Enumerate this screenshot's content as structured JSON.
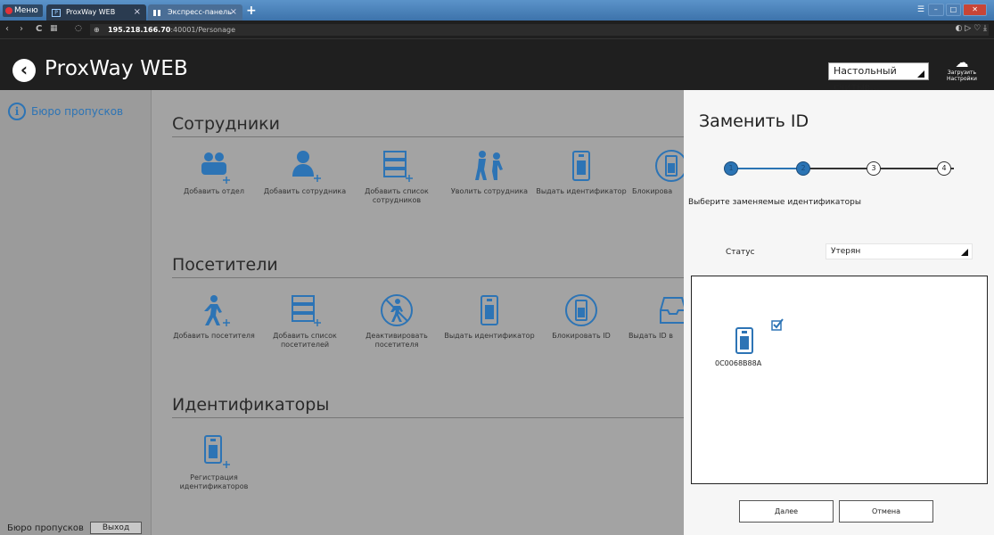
{
  "browser": {
    "menu_label": "Меню",
    "tabs": [
      {
        "label": "ProxWay WEB",
        "close": "×"
      },
      {
        "label": "Экспресс-панель",
        "close": "×"
      }
    ],
    "new_tab": "+",
    "address": {
      "host": "195.218.166.70",
      "path": ":40001/Personage"
    }
  },
  "header": {
    "title": "ProxWay WEB",
    "reader_select": "Настольный считыв...",
    "load_settings": [
      "Загрузить",
      "Настройки"
    ]
  },
  "sidebar": {
    "items": [
      {
        "label": "Бюро пропусков",
        "icon": "info-icon"
      }
    ],
    "footer_label": "Бюро пропусков",
    "logout_label": "Выход"
  },
  "sections": [
    {
      "title": "Сотрудники",
      "tiles": [
        {
          "label": "Добавить отдел",
          "icon": "add-department-icon"
        },
        {
          "label": "Добавить сотрудника",
          "icon": "add-employee-icon"
        },
        {
          "label": "Добавить список сотрудников",
          "icon": "add-employee-list-icon"
        },
        {
          "label": "Уволить сотрудника",
          "icon": "dismiss-employee-icon"
        },
        {
          "label": "Выдать идентификатор",
          "icon": "issue-id-icon"
        },
        {
          "label": "Блокирова",
          "icon": "block-id-icon"
        }
      ]
    },
    {
      "title": "Посетители",
      "tiles": [
        {
          "label": "Добавить посетителя",
          "icon": "add-visitor-icon"
        },
        {
          "label": "Добавить список посетителей",
          "icon": "add-visitor-list-icon"
        },
        {
          "label": "Деактивировать посетителя",
          "icon": "deactivate-visitor-icon"
        },
        {
          "label": "Выдать идентификатор",
          "icon": "issue-id-icon"
        },
        {
          "label": "Блокировать ID",
          "icon": "block-id-icon"
        },
        {
          "label": "Выдать ID в",
          "icon": "issue-id-tray-icon"
        }
      ]
    },
    {
      "title": "Идентификаторы",
      "tiles": [
        {
          "label": "Регистрация идентификаторов",
          "icon": "register-id-icon"
        }
      ]
    }
  ],
  "panel": {
    "title": "Заменить ID",
    "steps": [
      "1",
      "2",
      "3",
      "4"
    ],
    "current_step": 2,
    "instruction": "Выберите заменяемые идентификаторы",
    "status_label": "Статус",
    "status_value": "Утерян",
    "search_value": "",
    "items": [
      {
        "code": "0C0068B88A",
        "checked": true
      }
    ],
    "next_label": "Далее",
    "cancel_label": "Отмена"
  },
  "colors": {
    "accent": "#2d74b5",
    "header_bg": "#1f1f1f",
    "dim_bg": "#a3a3a3",
    "panel_bg": "#f6f6f6"
  }
}
